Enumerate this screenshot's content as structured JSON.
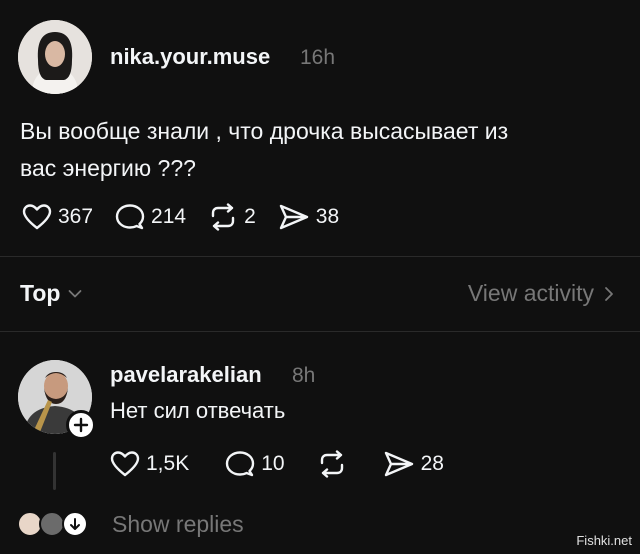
{
  "post": {
    "username": "nika.your.muse",
    "time": "16h",
    "text_line1": "Вы вообще знали , что дрочка высасывает из",
    "text_line2": "вас энергию ???",
    "likes": "367",
    "comments": "214",
    "reposts": "2",
    "shares": "38"
  },
  "sort": {
    "label": "Top",
    "view_activity": "View activity"
  },
  "reply": {
    "username": "pavelarakelian",
    "time": "8h",
    "text": "Нет сил отвечать",
    "likes": "1,5K",
    "comments": "10",
    "shares": "28"
  },
  "show_replies": "Show replies",
  "watermark": "Fishki.net",
  "icons": {
    "like": "heart-icon",
    "comment": "comment-bubble-icon",
    "repost": "repost-arrows-icon",
    "share": "send-arrow-icon",
    "sort": "chevron-down-icon",
    "activity": "chevron-right-icon",
    "follow": "plus-icon",
    "expand": "arrow-down-icon"
  },
  "colors": {
    "background": "#101010",
    "text": "#f3f5f7",
    "muted": "#777777",
    "divider": "#2a2a2a"
  }
}
